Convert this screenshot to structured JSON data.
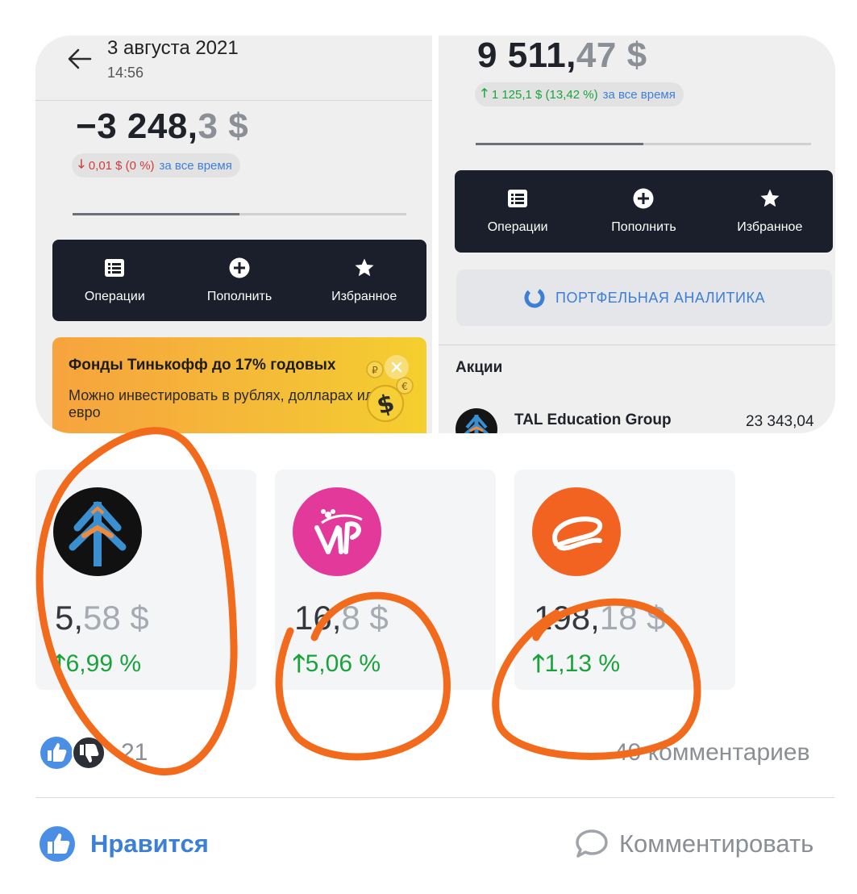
{
  "colors": {
    "accent_blue": "#3b80d6",
    "up_green": "#1aa33b",
    "down_red": "#d33b3b",
    "nav_dark": "#1b1f2c",
    "annotation_orange": "#f26a1b"
  },
  "left_screen": {
    "header": {
      "date": "3 августа 2021",
      "time": "14:56",
      "back_icon": "arrow-left-icon"
    },
    "balance": {
      "integer": "−3 248,",
      "fraction": "3 $"
    },
    "change": {
      "arrow": "🡓",
      "text": "0,01 $ (0 %)",
      "period": "за все время"
    },
    "progress": 0.5,
    "nav": [
      {
        "label": "Операции",
        "icon": "list-icon"
      },
      {
        "label": "Пополнить",
        "icon": "plus-circle-icon"
      },
      {
        "label": "Избранное",
        "icon": "star-icon"
      }
    ],
    "promo": {
      "title": "Фонды Тинькофф до 17% годовых",
      "text": "Можно инвестировать в рублях, долларах или евро",
      "close_icon": "close-icon",
      "coins": [
        "₽",
        "€",
        "$"
      ]
    }
  },
  "right_screen": {
    "balance": {
      "integer": "9 511,",
      "fraction": "47 $"
    },
    "change": {
      "arrow": "🡑",
      "text": "1 125,1 $ (13,42 %)",
      "period": "за все время"
    },
    "progress": 0.5,
    "nav": [
      {
        "label": "Операции",
        "icon": "list-icon"
      },
      {
        "label": "Пополнить",
        "icon": "plus-circle-icon"
      },
      {
        "label": "Избранное",
        "icon": "star-icon"
      }
    ],
    "analytics_label": "ПОРТФЕЛЬНАЯ АНАЛИТИКА",
    "section_title": "Акции",
    "stock": {
      "name": "TAL Education Group",
      "value": "23 343,04"
    }
  },
  "cards": [
    {
      "logo": "tal-tree-logo",
      "price_int": "5,",
      "price_frac": "58  $",
      "change": "6,99 %"
    },
    {
      "logo": "vipshop-logo",
      "price_int": "16,",
      "price_frac": "8  $",
      "change": "5,06 %"
    },
    {
      "logo": "alibaba-logo",
      "price_int": "198,",
      "price_frac": "18  $",
      "change": "1,13 %"
    }
  ],
  "footer": {
    "reactions_count": "21",
    "comments": "40 комментариев",
    "like_label": "Нравится",
    "comment_label": "Комментировать"
  }
}
